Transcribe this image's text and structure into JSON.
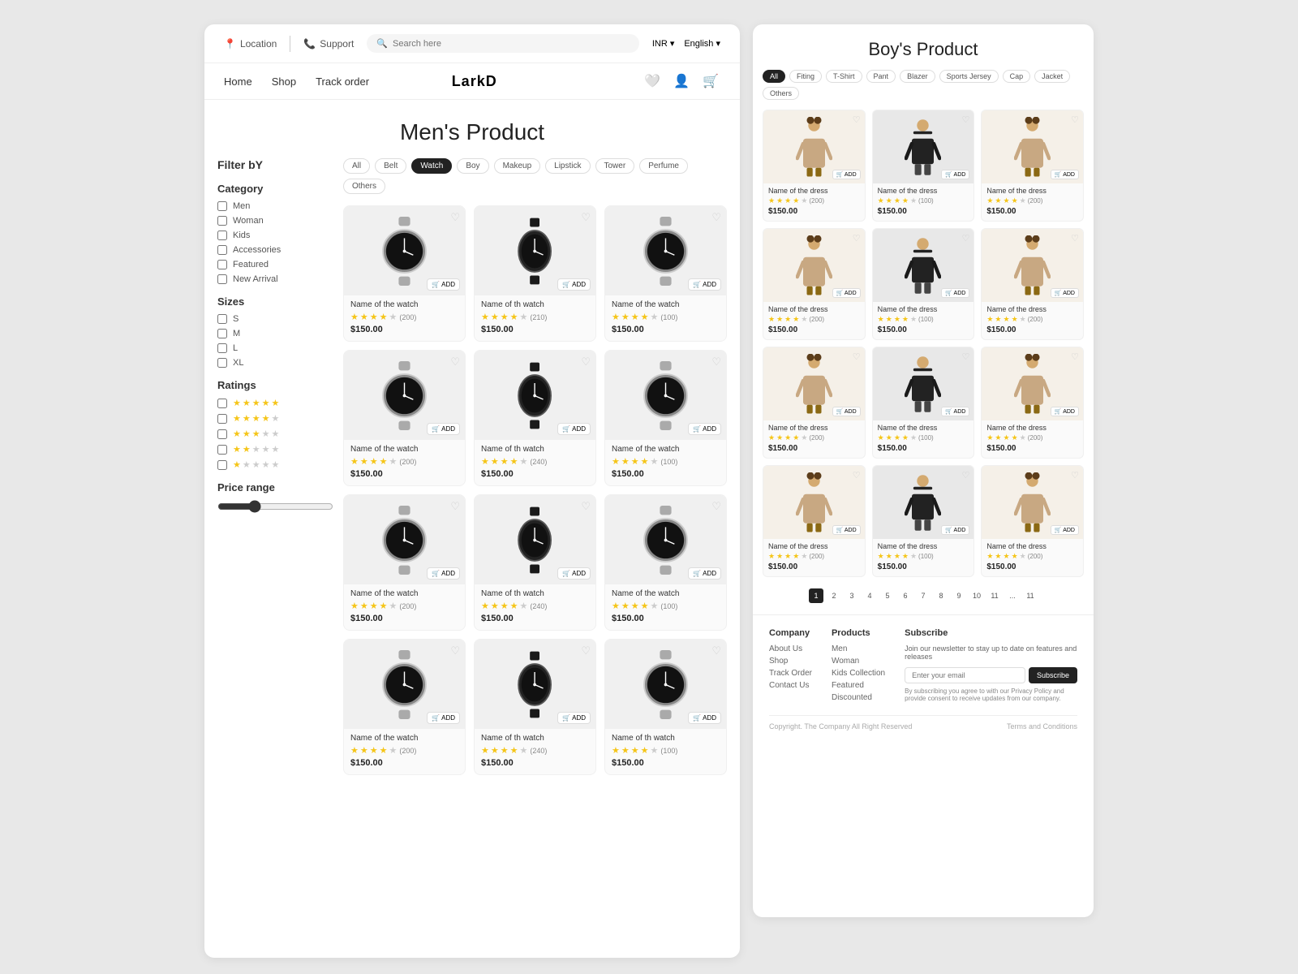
{
  "left": {
    "header": {
      "location_label": "Location",
      "support_label": "Support",
      "search_placeholder": "Search here",
      "currency": "INR ▾",
      "language": "English ▾"
    },
    "nav": {
      "home": "Home",
      "shop": "Shop",
      "track_order": "Track order",
      "brand": "LarkD"
    },
    "page_title": "Men's Product",
    "filter": {
      "title": "Filter bY",
      "category_title": "Category",
      "categories": [
        "Men",
        "Woman",
        "Kids",
        "Accessories",
        "Featured",
        "New Arrival"
      ],
      "sizes_title": "Sizes",
      "sizes": [
        "S",
        "M",
        "L",
        "XL"
      ],
      "ratings_title": "Ratings",
      "price_range_title": "Price range"
    },
    "product_tabs": [
      "All",
      "Belt",
      "Watch",
      "Boy",
      "Makeup",
      "Lipstick",
      "Tower",
      "Perfume",
      "Others"
    ],
    "active_tab": "Watch",
    "products": [
      {
        "name": "Name of the watch",
        "price": "$150.00",
        "rating_count": "(200)",
        "stars": 4
      },
      {
        "name": "Name of th watch",
        "price": "$150.00",
        "rating_count": "(210)",
        "stars": 4,
        "dark": true
      },
      {
        "name": "Name of the watch",
        "price": "$150.00",
        "rating_count": "(100)",
        "stars": 4
      },
      {
        "name": "Name of the watch",
        "price": "$150.00",
        "rating_count": "(200)",
        "stars": 4
      },
      {
        "name": "Name of th watch",
        "price": "$150.00",
        "rating_count": "(240)",
        "stars": 4,
        "dark": true
      },
      {
        "name": "Name of the watch",
        "price": "$150.00",
        "rating_count": "(100)",
        "stars": 4
      },
      {
        "name": "Name of the watch",
        "price": "$150.00",
        "rating_count": "(200)",
        "stars": 4
      },
      {
        "name": "Name of th watch",
        "price": "$150.00",
        "rating_count": "(240)",
        "stars": 4,
        "dark": true
      },
      {
        "name": "Name of the watch",
        "price": "$150.00",
        "rating_count": "(100)",
        "stars": 4
      },
      {
        "name": "Name of the watch",
        "price": "$150.00",
        "rating_count": "(200)",
        "stars": 4
      },
      {
        "name": "Name of th watch",
        "price": "$150.00",
        "rating_count": "(240)",
        "stars": 4,
        "dark": true
      },
      {
        "name": "Name of th watch",
        "price": "$150.00",
        "rating_count": "(100)",
        "stars": 4
      }
    ],
    "add_label": "+ ADD",
    "ratings_options": [
      5,
      4,
      3,
      2,
      1
    ]
  },
  "right": {
    "page_title": "Boy's Product",
    "filter_tabs": [
      "All",
      "Fiting",
      "T-Shirt",
      "Pant",
      "Blazer",
      "Sports Jersey",
      "Cap",
      "Jacket",
      "Others"
    ],
    "active_tab": "All",
    "products": [
      {
        "name": "Name of the dress",
        "price": "$150.00",
        "rating_count": "(200)",
        "stars": 4,
        "type": "girl"
      },
      {
        "name": "Name of the dress",
        "price": "$150.00",
        "rating_count": "(100)",
        "stars": 4,
        "type": "boy"
      },
      {
        "name": "Name of the dress",
        "price": "$150.00",
        "rating_count": "(200)",
        "stars": 4,
        "type": "girl"
      },
      {
        "name": "Name of the dress",
        "price": "$150.00",
        "rating_count": "(200)",
        "stars": 4,
        "type": "girl"
      },
      {
        "name": "Name of the dress",
        "price": "$150.00",
        "rating_count": "(100)",
        "stars": 4,
        "type": "boy"
      },
      {
        "name": "Name of the dress",
        "price": "$150.00",
        "rating_count": "(200)",
        "stars": 4,
        "type": "girl"
      },
      {
        "name": "Name of the dress",
        "price": "$150.00",
        "rating_count": "(200)",
        "stars": 4,
        "type": "girl"
      },
      {
        "name": "Name of the dress",
        "price": "$150.00",
        "rating_count": "(100)",
        "stars": 4,
        "type": "boy"
      },
      {
        "name": "Name of the dress",
        "price": "$150.00",
        "rating_count": "(200)",
        "stars": 4,
        "type": "girl"
      },
      {
        "name": "Name of the dress",
        "price": "$150.00",
        "rating_count": "(200)",
        "stars": 4,
        "type": "girl"
      },
      {
        "name": "Name of the dress",
        "price": "$150.00",
        "rating_count": "(100)",
        "stars": 4,
        "type": "boy"
      },
      {
        "name": "Name of the dress",
        "price": "$150.00",
        "rating_count": "(200)",
        "stars": 4,
        "type": "girl"
      }
    ],
    "add_label": "+ ADD",
    "pagination": [
      "1",
      "2",
      "3",
      "4",
      "5",
      "6",
      "7",
      "8",
      "9",
      "10",
      "11",
      "...",
      "11"
    ],
    "footer": {
      "company_title": "Company",
      "company_links": [
        "About Us",
        "Shop",
        "Track Order",
        "Contact Us"
      ],
      "products_title": "Products",
      "product_links": [
        "Men",
        "Woman",
        "Kids Collection",
        "Featured",
        "Discounted"
      ],
      "subscribe_title": "Subscribe",
      "subscribe_desc": "Join our newsletter to stay up to date on features and releases",
      "subscribe_placeholder": "Enter your email",
      "subscribe_btn": "Subscribe",
      "subscribe_note": "By subscribing you agree to with our Privacy Policy and provide consent to receive updates from our company.",
      "copyright": "Copyright. The Company All Right Reserved",
      "terms": "Terms and Conditions"
    }
  }
}
